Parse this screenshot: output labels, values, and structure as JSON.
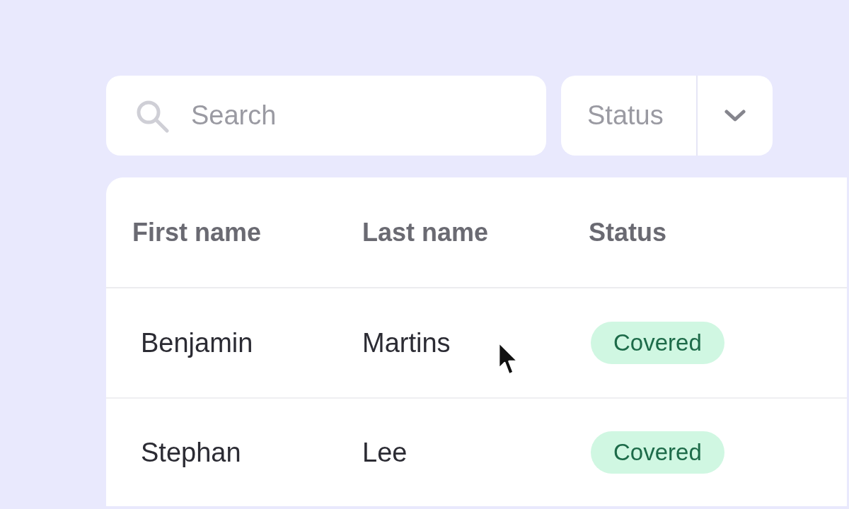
{
  "search": {
    "placeholder": "Search"
  },
  "status_filter": {
    "label": "Status"
  },
  "table": {
    "columns": [
      "First name",
      "Last name",
      "Status"
    ],
    "rows": [
      {
        "first_name": "Benjamin",
        "last_name": "Martins",
        "status": "Covered"
      },
      {
        "first_name": "Stephan",
        "last_name": "Lee",
        "status": "Covered"
      }
    ]
  }
}
